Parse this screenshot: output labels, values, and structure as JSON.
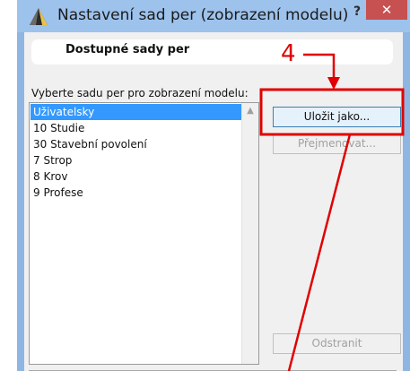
{
  "window": {
    "title": "Nastavení sad per (zobrazení modelu)",
    "help_label": "?",
    "close_label": "✕"
  },
  "section": {
    "header": "Dostupné sady per",
    "instruction": "Vyberte sadu per pro zobrazení modelu:"
  },
  "list": {
    "items": [
      {
        "label": "Uživatelsky",
        "selected": true
      },
      {
        "label": "10 Studie",
        "selected": false
      },
      {
        "label": "30 Stavební povolení",
        "selected": false
      },
      {
        "label": "7 Strop",
        "selected": false
      },
      {
        "label": "8 Krov",
        "selected": false
      },
      {
        "label": "9 Profese",
        "selected": false
      }
    ],
    "scroll_up_icon": "▲"
  },
  "buttons": {
    "save_as": "Uložit jako...",
    "rename": "Přejmenovat...",
    "delete": "Odstranit"
  },
  "annotation": {
    "step": "4",
    "color": "#e00000"
  },
  "colors": {
    "titlebar": "#9dc2ec",
    "close": "#c75050",
    "selection": "#3399ff"
  }
}
